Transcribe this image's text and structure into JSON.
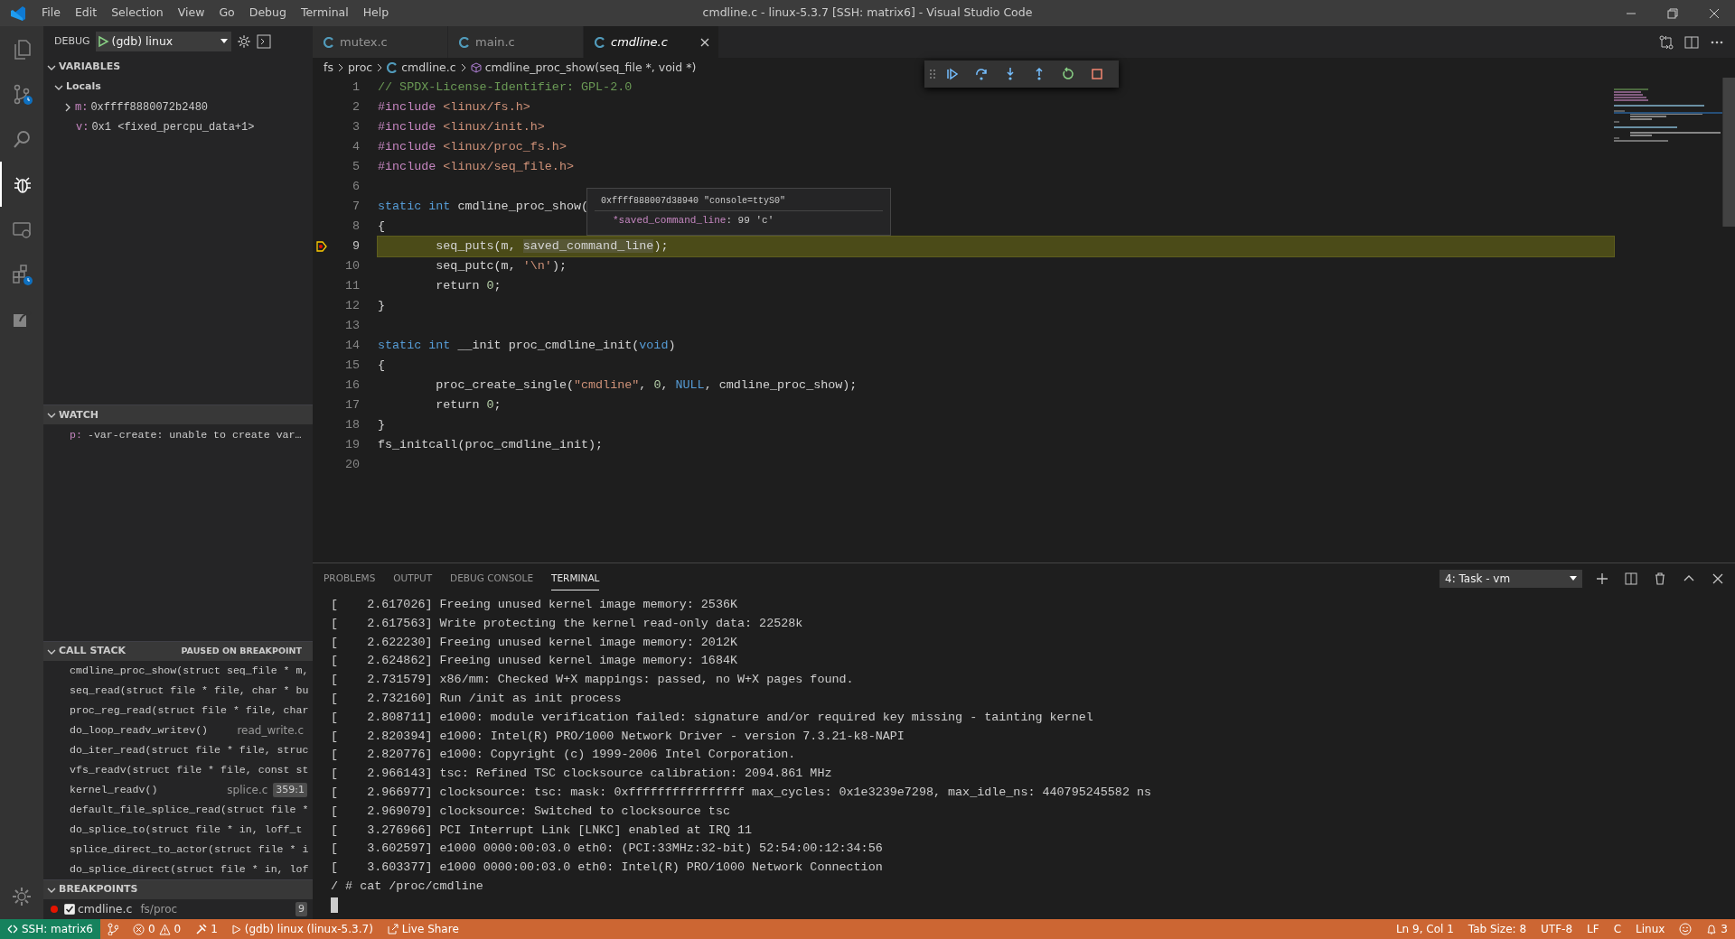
{
  "window": {
    "title": "cmdline.c - linux-5.3.7 [SSH: matrix6] - Visual Studio Code"
  },
  "menu": [
    "File",
    "Edit",
    "Selection",
    "View",
    "Go",
    "Debug",
    "Terminal",
    "Help"
  ],
  "activity_bar": [
    {
      "selected": false
    },
    {
      "selected": false
    },
    {
      "selected": false
    },
    {
      "selected": true
    },
    {
      "selected": false
    },
    {
      "selected": false
    },
    {
      "selected": false
    }
  ],
  "debug_toolbar": {
    "label": "DEBUG",
    "configuration": "(gdb) linux"
  },
  "variables": {
    "title": "VARIABLES",
    "expanded": true,
    "scopes": [
      {
        "name": "Locals",
        "expanded": true,
        "children": [
          {
            "name": "m:",
            "value": "0xffff8880072b2480",
            "expandable": true
          },
          {
            "name": "v:",
            "value": "0x1 <fixed_percpu_data+1>",
            "expandable": false
          }
        ]
      }
    ]
  },
  "watch": {
    "title": "WATCH",
    "expanded": true,
    "items": [
      {
        "name": "p:",
        "value": "-var-create: unable to create var…"
      }
    ]
  },
  "call_stack": {
    "title": "CALL STACK",
    "expanded": true,
    "status": "PAUSED ON BREAKPOINT",
    "frames": [
      {
        "name": "cmdline_proc_show(struct seq_file * m,"
      },
      {
        "name": "seq_read(struct file * file, char * bu"
      },
      {
        "name": "proc_reg_read(struct file * file, char"
      },
      {
        "name": "do_loop_readv_writev()",
        "file": "read_write.c"
      },
      {
        "name": "do_iter_read(struct file * file, struc"
      },
      {
        "name": "vfs_readv(struct file * file, const st"
      },
      {
        "name": "kernel_readv()",
        "file": "splice.c",
        "position": "359:1"
      },
      {
        "name": "default_file_splice_read(struct file *"
      },
      {
        "name": "do_splice_to(struct file * in, loff_t"
      },
      {
        "name": "splice_direct_to_actor(struct file * i"
      },
      {
        "name": "do_splice_direct(struct file * in, lof"
      }
    ]
  },
  "breakpoints": {
    "title": "BREAKPOINTS",
    "expanded": true,
    "items": [
      {
        "file": "cmdline.c",
        "path": "fs/proc",
        "line": "9",
        "checked": true
      }
    ]
  },
  "editor": {
    "tabs": [
      {
        "label": "mutex.c",
        "selected": false,
        "preview": false
      },
      {
        "label": "main.c",
        "selected": false,
        "preview": false
      },
      {
        "label": "cmdline.c",
        "selected": true,
        "preview": true
      }
    ],
    "breadcrumbs": [
      "fs",
      "proc",
      "cmdline.c",
      "cmdline_proc_show(seq_file *, void *)"
    ],
    "lines": [
      {
        "number": "1",
        "current": false,
        "tokens": [
          {
            "t": "// SPDX-License-Identifier: GPL-2.0",
            "kind": "comment"
          }
        ]
      },
      {
        "number": "2",
        "current": false,
        "tokens": [
          {
            "t": "#include",
            "kind": "directive"
          },
          {
            "t": " <linux/fs.h>",
            "kind": "string"
          }
        ]
      },
      {
        "number": "3",
        "current": false,
        "tokens": [
          {
            "t": "#include",
            "kind": "directive"
          },
          {
            "t": " <linux/init.h>",
            "kind": "string"
          }
        ]
      },
      {
        "number": "4",
        "current": false,
        "tokens": [
          {
            "t": "#include",
            "kind": "directive"
          },
          {
            "t": " <linux/proc_fs.h>",
            "kind": "string"
          }
        ]
      },
      {
        "number": "5",
        "current": false,
        "tokens": [
          {
            "t": "#include",
            "kind": "directive"
          },
          {
            "t": " <linux/seq_file.h>",
            "kind": "string"
          }
        ]
      },
      {
        "number": "6",
        "current": false
      },
      {
        "number": "7",
        "current": false,
        "tokens": [
          {
            "t": "static int",
            "kind": "keyword"
          },
          {
            "t": " cmdline_proc_show(",
            "kind": "plain"
          }
        ]
      },
      {
        "number": "8",
        "current": false,
        "tokens": [
          {
            "t": "{",
            "kind": "plain"
          }
        ]
      },
      {
        "number": "9",
        "current": true,
        "tokens": [
          {
            "t": "        seq_puts(m, ",
            "kind": "plain"
          },
          {
            "t": "saved_command_line",
            "kind": "highlight"
          },
          {
            "t": ");",
            "kind": "plain"
          }
        ]
      },
      {
        "number": "10",
        "current": false,
        "tokens": [
          {
            "t": "        seq_putc(m, ",
            "kind": "plain"
          },
          {
            "t": "'\\n'",
            "kind": "string"
          },
          {
            "t": ");",
            "kind": "plain"
          }
        ]
      },
      {
        "number": "11",
        "current": false,
        "tokens": [
          {
            "t": "        return ",
            "kind": "plain"
          },
          {
            "t": "0",
            "kind": "number"
          },
          {
            "t": ";",
            "kind": "plain"
          }
        ]
      },
      {
        "number": "12",
        "current": false,
        "tokens": [
          {
            "t": "}",
            "kind": "plain"
          }
        ]
      },
      {
        "number": "13",
        "current": false
      },
      {
        "number": "14",
        "current": false,
        "tokens": [
          {
            "t": "static int",
            "kind": "keyword"
          },
          {
            "t": " __init proc_cmdline_init(",
            "kind": "plain"
          },
          {
            "t": "void",
            "kind": "keyword"
          },
          {
            "t": ")",
            "kind": "plain"
          }
        ]
      },
      {
        "number": "15",
        "current": false,
        "tokens": [
          {
            "t": "{",
            "kind": "plain"
          }
        ]
      },
      {
        "number": "16",
        "current": false,
        "tokens": [
          {
            "t": "        proc_create_single(",
            "kind": "plain"
          },
          {
            "t": "\"cmdline\"",
            "kind": "string"
          },
          {
            "t": ", ",
            "kind": "plain"
          },
          {
            "t": "0",
            "kind": "number"
          },
          {
            "t": ", ",
            "kind": "plain"
          },
          {
            "t": "NULL",
            "kind": "keyword"
          },
          {
            "t": ", cmdline_proc_show);",
            "kind": "plain"
          }
        ]
      },
      {
        "number": "17",
        "current": false,
        "tokens": [
          {
            "t": "        return ",
            "kind": "plain"
          },
          {
            "t": "0",
            "kind": "number"
          },
          {
            "t": ";",
            "kind": "plain"
          }
        ]
      },
      {
        "number": "18",
        "current": false,
        "tokens": [
          {
            "t": "}",
            "kind": "plain"
          }
        ]
      },
      {
        "number": "19",
        "current": false,
        "tokens": [
          {
            "t": "fs_initcall(proc_cmdline_init);",
            "kind": "plain"
          }
        ]
      },
      {
        "number": "20",
        "current": false
      }
    ],
    "hover": {
      "header": "0xffff888007d38940 \"console=ttyS0\"",
      "name": "*saved_command_line",
      "value": ": 99 'c'"
    }
  },
  "panel": {
    "tabs": [
      {
        "label": "PROBLEMS",
        "selected": false
      },
      {
        "label": "OUTPUT",
        "selected": false
      },
      {
        "label": "DEBUG CONSOLE",
        "selected": false
      },
      {
        "label": "TERMINAL",
        "selected": true
      }
    ],
    "terminal_selector": "4: Task - vm",
    "lines": [
      "[    2.617026] Freeing unused kernel image memory: 2536K",
      "[    2.617563] Write protecting the kernel read-only data: 22528k",
      "[    2.622230] Freeing unused kernel image memory: 2012K",
      "[    2.624862] Freeing unused kernel image memory: 1684K",
      "[    2.731579] x86/mm: Checked W+X mappings: passed, no W+X pages found.",
      "[    2.732160] Run /init as init process",
      "[    2.808711] e1000: module verification failed: signature and/or required key missing - tainting kernel",
      "[    2.820394] e1000: Intel(R) PRO/1000 Network Driver - version 7.3.21-k8-NAPI",
      "[    2.820776] e1000: Copyright (c) 1999-2006 Intel Corporation.",
      "[    2.966143] tsc: Refined TSC clocksource calibration: 2094.861 MHz",
      "[    2.966977] clocksource: tsc: mask: 0xffffffffffffffff max_cycles: 0x1e3239e7298, max_idle_ns: 440795245582 ns",
      "[    2.969079] clocksource: Switched to clocksource tsc",
      "[    3.276966] PCI Interrupt Link [LNKC] enabled at IRQ 11",
      "[    3.602597] e1000 0000:00:03.0 eth0: (PCI:33MHz:32-bit) 52:54:00:12:34:56",
      "[    3.603377] e1000 0000:00:03.0 eth0: Intel(R) PRO/1000 Network Connection",
      "/ # cat /proc/cmdline"
    ]
  },
  "status_bar": {
    "remote": "SSH: matrix6",
    "errors": "0",
    "warnings": "0",
    "tools": "1",
    "debug": "(gdb) linux (linux-5.3.7)",
    "live_share": "Live Share",
    "right": [
      "Ln 9, Col 1",
      "Tab Size: 8",
      "UTF-8",
      "LF",
      "C",
      "Linux"
    ],
    "notifications": "3"
  }
}
